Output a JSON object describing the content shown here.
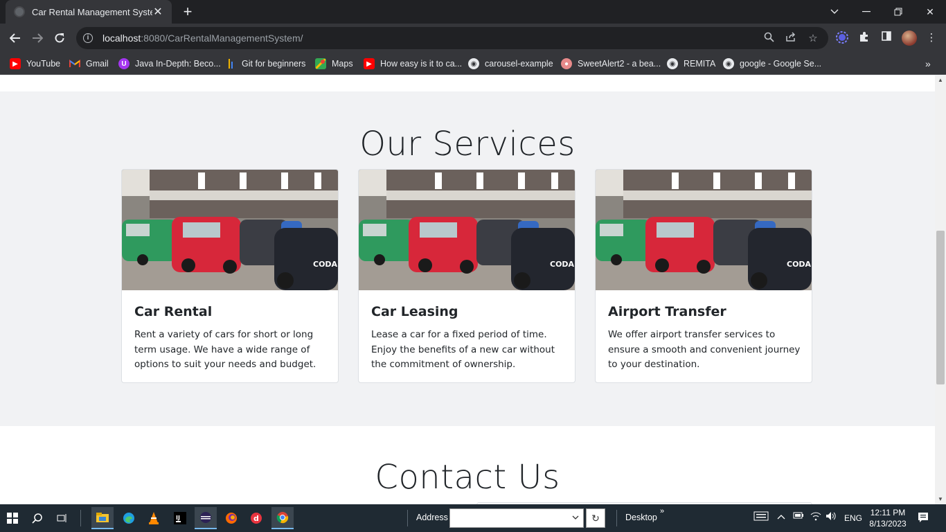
{
  "browser": {
    "tab_title": "Car Rental Management System",
    "url_host": "localhost",
    "url_rest": ":8080/CarRentalManagementSystem/"
  },
  "bookmarks": [
    {
      "label": "YouTube",
      "icon": "youtube-icon",
      "color": "#ff0000"
    },
    {
      "label": "Gmail",
      "icon": "gmail-icon",
      "color": "#ea4335"
    },
    {
      "label": "Java In-Depth: Beco...",
      "icon": "udemy-icon",
      "color": "#a435f0"
    },
    {
      "label": "Git for beginners",
      "icon": "git-bars-icon",
      "color": "#f0b400"
    },
    {
      "label": "Maps",
      "icon": "maps-icon",
      "color": "#34a853"
    },
    {
      "label": "How easy is it to ca...",
      "icon": "youtube-icon",
      "color": "#ff0000"
    },
    {
      "label": "carousel-example",
      "icon": "globe-icon",
      "color": "#e8eaed"
    },
    {
      "label": "SweetAlert2 - a bea...",
      "icon": "sweetalert-icon",
      "color": "#e88a8a"
    },
    {
      "label": "REMITA",
      "icon": "globe-icon",
      "color": "#e8eaed"
    },
    {
      "label": "google - Google Se...",
      "icon": "globe-icon",
      "color": "#e8eaed"
    }
  ],
  "page": {
    "services_title": "Our Services",
    "contact_title": "Contact Us",
    "services": [
      {
        "title": "Car Rental",
        "text": "Rent a variety of cars for short or long term usage. We have a wide range of options to suit your needs and budget."
      },
      {
        "title": "Car Leasing",
        "text": "Lease a car for a fixed period of time. Enjoy the benefits of a new car without the commitment of ownership."
      },
      {
        "title": "Airport Transfer",
        "text": "We offer airport transfer services to ensure a smooth and convenient journey to your destination."
      }
    ]
  },
  "taskbar": {
    "address_label": "Address",
    "desktop_label": "Desktop",
    "language": "ENG",
    "time": "12:11 PM",
    "date": "8/13/2023"
  },
  "colors": {
    "section_bg": "#f1f2f4",
    "chrome_dark": "#35363a",
    "taskbar": "#1f2a33"
  }
}
